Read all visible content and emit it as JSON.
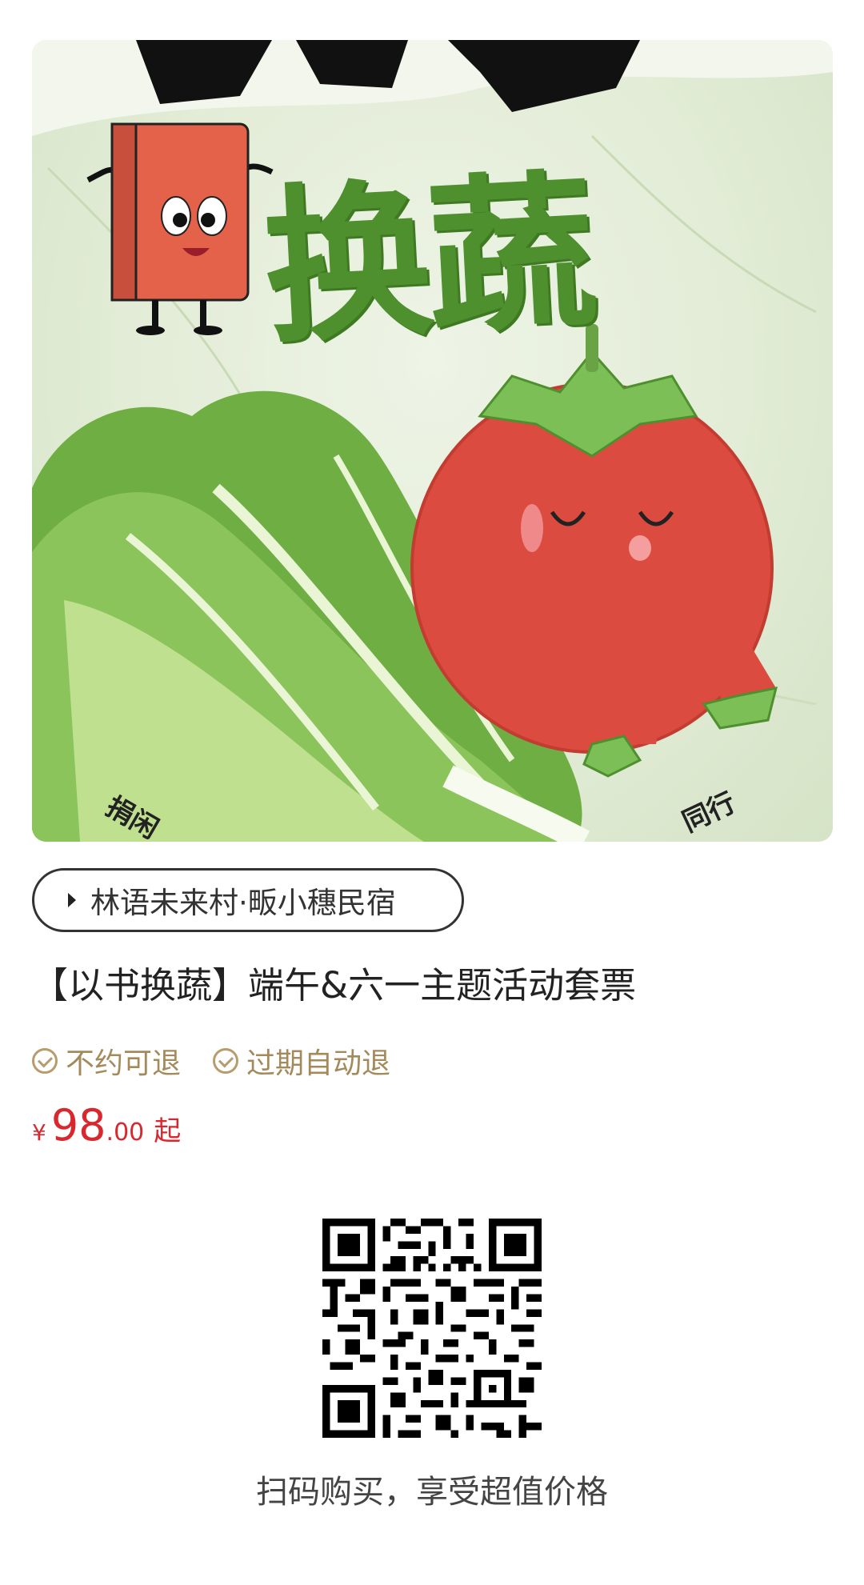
{
  "poster": {
    "headline": "换蔬",
    "corner_left_text": "捐闲",
    "corner_right_text": "同行"
  },
  "venue": {
    "name": "林语未来村·畈小穗民宿"
  },
  "product": {
    "title": "【以书换蔬】端午&六一主题活动套票",
    "tags": [
      "不约可退",
      "过期自动退"
    ]
  },
  "price": {
    "currency": "¥",
    "integer": "98",
    "decimal": ".00",
    "suffix": "起"
  },
  "qr": {
    "caption": "扫码购买，享受超值价格"
  },
  "colors": {
    "accent_red": "#d9272d",
    "tag_gold": "#a48a5b",
    "headline_green": "#4e8f2e"
  }
}
